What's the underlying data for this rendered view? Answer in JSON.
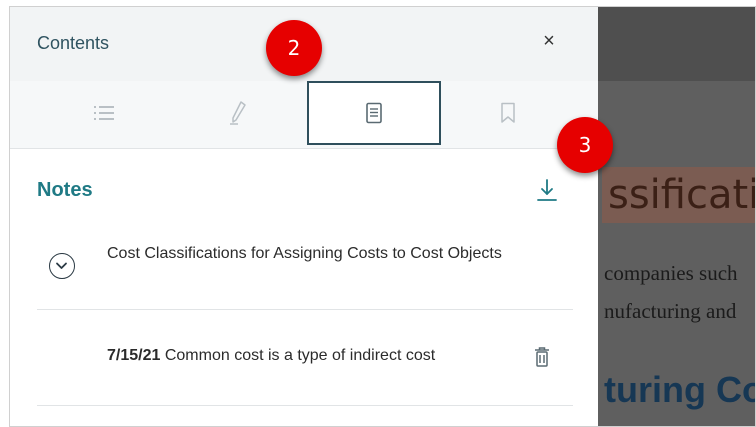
{
  "panel": {
    "title": "Contents",
    "close_label": "×"
  },
  "tabs": [
    {
      "icon": "list-icon",
      "active": false
    },
    {
      "icon": "pencil-icon",
      "active": false
    },
    {
      "icon": "notes-icon",
      "active": true
    },
    {
      "icon": "bookmark-icon",
      "active": false
    }
  ],
  "notes": {
    "title": "Notes",
    "download_icon": "download-icon",
    "group": {
      "title": "Cost Classifications for Assigning Costs to Cost Objects",
      "expand_icon": "chevron-down-circle-icon"
    },
    "items": [
      {
        "date": "7/15/21",
        "text": "Common cost is a type of indirect cost",
        "delete_icon": "trash-icon"
      }
    ]
  },
  "callouts": [
    {
      "label": "2"
    },
    {
      "label": "3"
    }
  ],
  "background_page": {
    "title_fragment": "ssificatio",
    "line1": "companies such",
    "line2": "nufacturing and",
    "heading_fragment": "turing Co"
  },
  "colors": {
    "accent": "#1f7a85",
    "callout": "#e60000",
    "header_bg": "#f2f4f5",
    "active_tab_border": "#2f4f5c"
  }
}
